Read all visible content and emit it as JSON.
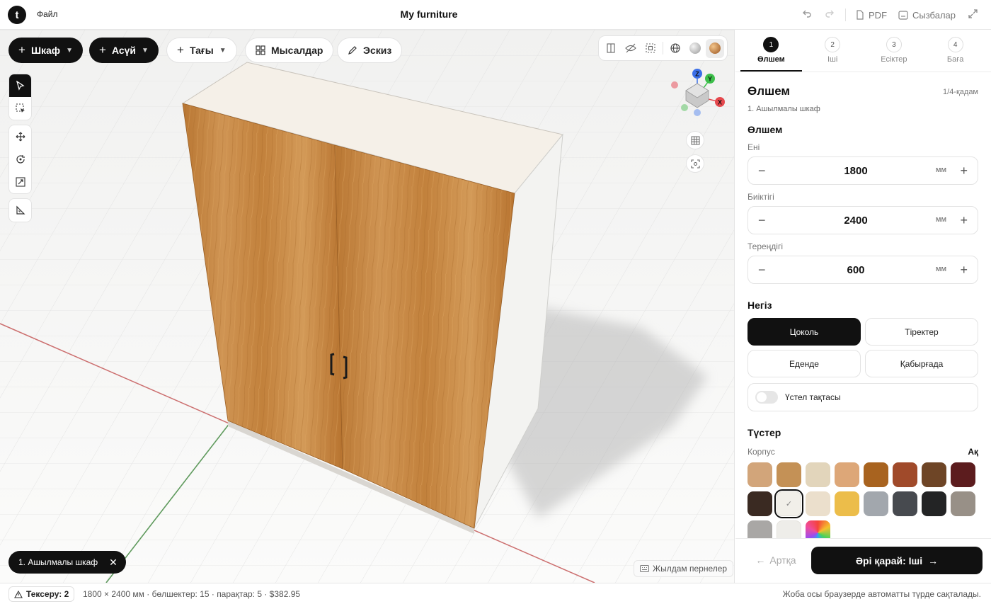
{
  "app": {
    "logo_letter": "t",
    "menu_file": "Файл",
    "title": "My furniture",
    "pdf_label": "PDF",
    "drawings_label": "Сызбалар"
  },
  "toolbar": {
    "cabinet_label": "Шкаф",
    "hanging_label": "Асүй",
    "more_label": "Тағы",
    "examples_label": "Мысалдар",
    "sketch_label": "Эскиз"
  },
  "gizmo": {
    "x": "X",
    "y": "Y",
    "z": "Z"
  },
  "viewport": {
    "selection_chip": "1. Ашылмалы шкаф",
    "shortcuts_label": "Жылдам пернелер"
  },
  "steps": [
    {
      "num": "1",
      "label": "Өлшем",
      "active": true
    },
    {
      "num": "2",
      "label": "Іші",
      "active": false
    },
    {
      "num": "3",
      "label": "Есіктер",
      "active": false
    },
    {
      "num": "4",
      "label": "Баға",
      "active": false
    }
  ],
  "panel": {
    "title": "Өлшем",
    "step_count": "1/4-қадам",
    "subtitle": "1. Ашылмалы шкаф",
    "dims_heading": "Өлшем",
    "width_label": "Ені",
    "width_value": "1800",
    "height_label": "Биіктігі",
    "height_value": "2400",
    "depth_label": "Тереңдігі",
    "depth_value": "600",
    "unit": "мм",
    "base_heading": "Негіз",
    "base_options": [
      "Цоколь",
      "Тіректер",
      "Еденде",
      "Қабырғада"
    ],
    "base_selected": "Цоколь",
    "countertop_label": "Үстел тақтасы",
    "countertop_on": false,
    "colors_heading": "Түстер",
    "body_label": "Корпус",
    "body_value": "Ақ",
    "swatches": [
      "#d2a57a",
      "#c49156",
      "#e2d5bb",
      "#dda778",
      "#a8631f",
      "#a04a2a",
      "#6e4526",
      "#5c1c1e",
      "#3a2a22",
      "#f1efe9",
      "#ebdfcc",
      "#ecbd4a",
      "#a2a7ad",
      "#474a4f",
      "#232425",
      "#989087",
      "#a9a7a5",
      "#eeede9",
      "rainbow"
    ],
    "swatch_selected_index": 9,
    "back_label": "Артқа",
    "next_label": "Әрі қарай: Іші"
  },
  "status": {
    "check_label": "Тексеру: 2",
    "stats": "1800 × 2400 мм · бөлшектер: 15 · парақтар: 5 · $382.95",
    "autosave": "Жоба осы браузерде автоматты түрде сақталады."
  },
  "colors": {
    "accent": "#111111",
    "door_wood": "#c98a45",
    "axis_x": "#e5484d",
    "axis_y": "#3cbf4a",
    "axis_z": "#3b6fe8"
  }
}
